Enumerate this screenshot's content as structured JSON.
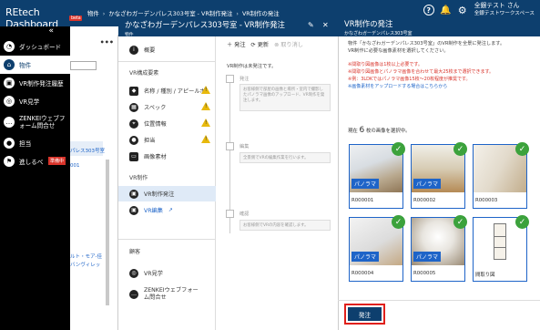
{
  "app": {
    "brand": "REtech Dashboard",
    "beta": "beta"
  },
  "breadcrumb": [
    "物件",
    "かなざわガーデンパレス303号室 - VR制作発注",
    "VR制作の発注"
  ],
  "header": {
    "user_name": "全銀テスト さん",
    "user_org": "全銀テストワークスペース"
  },
  "sidebar": {
    "collapse": "«",
    "items": [
      {
        "label": "ダッシュボード",
        "icon": "dashboard-icon"
      },
      {
        "label": "物件",
        "icon": "home-icon"
      },
      {
        "label": "VR制作発注履歴",
        "icon": "vr-icon"
      },
      {
        "label": "VR見学",
        "icon": "eye-icon"
      },
      {
        "label": "ZENKEIウェブフォーム問合せ",
        "icon": "chat-icon"
      },
      {
        "label": "担当",
        "icon": "person-icon"
      },
      {
        "label": "進しるべ",
        "icon": "flag-icon",
        "badge": "準備中"
      }
    ]
  },
  "listpanel": {
    "menu": "•••",
    "text1": "パレス303号室",
    "text2": "001",
    "text3": "ルト・モア-佳",
    "text4": "バンヴィレッ"
  },
  "main": {
    "title": "かなざわガーデンパレス303号室 - VR制作発注",
    "subtitle": "物件",
    "nav": {
      "overview": "概要",
      "section_vr": "VR構成要素",
      "items": [
        "名称 / 種別 / アピールポ",
        "スペック",
        "位置情報",
        "担当",
        "画像素材"
      ],
      "section_vr2": "VR制作",
      "vr_order": "VR制作発注",
      "vr_edit": "VR編集",
      "section_other": "顧客",
      "vr_tour": "VR見学",
      "webform": "ZENKEIウェブフォーム問合せ"
    },
    "tools": {
      "add": "発注",
      "refresh": "更新",
      "cancel": "取り消し"
    },
    "intro": "VR制作は未発注です。",
    "steps": [
      {
        "title": "発注",
        "desc": "お客様側で部屋の画像と場所・室内で撮影したパノラマ画像のアップロード、VR制作を発注します。"
      },
      {
        "title": "編集",
        "desc": "全景側でVRの編集作業を行います。"
      },
      {
        "title": "確認",
        "desc": "お客様側でVRの内容を確認します。"
      }
    ]
  },
  "right": {
    "title": "VR制作の発注",
    "subtitle": "かなざわガーデンパレス303号室",
    "desc1": "物件「かなざわガーデンパレス303号室」のVR制作を全景に発注します。",
    "desc2": "VR制作に必要な画像素材を選択してください。",
    "req1": "※間取り図画像は1枚以上必要です。",
    "req2": "※間取り図画像とパノラマ画像を合わせて最大25枚まで選択できます。",
    "req3": "※例：3LDKではパノラマ画像15枚〜20枚程度が推奨です。",
    "link": "※画像素材をアップロードする場合はこちらから",
    "count_prefix": "現在",
    "count": "6",
    "count_suffix": "枚の画像を選択中。",
    "tiles": [
      {
        "id": "R000001",
        "pano": "パノラマ",
        "selected": true
      },
      {
        "id": "R000002",
        "pano": "パノラマ",
        "selected": true
      },
      {
        "id": "R000003",
        "pano": "",
        "selected": true
      },
      {
        "id": "R000004",
        "pano": "パノラマ",
        "selected": true
      },
      {
        "id": "R000005",
        "pano": "パノラマ",
        "selected": true
      },
      {
        "id": "間取り図",
        "pano": "",
        "selected": true
      }
    ],
    "submit": "発注"
  }
}
